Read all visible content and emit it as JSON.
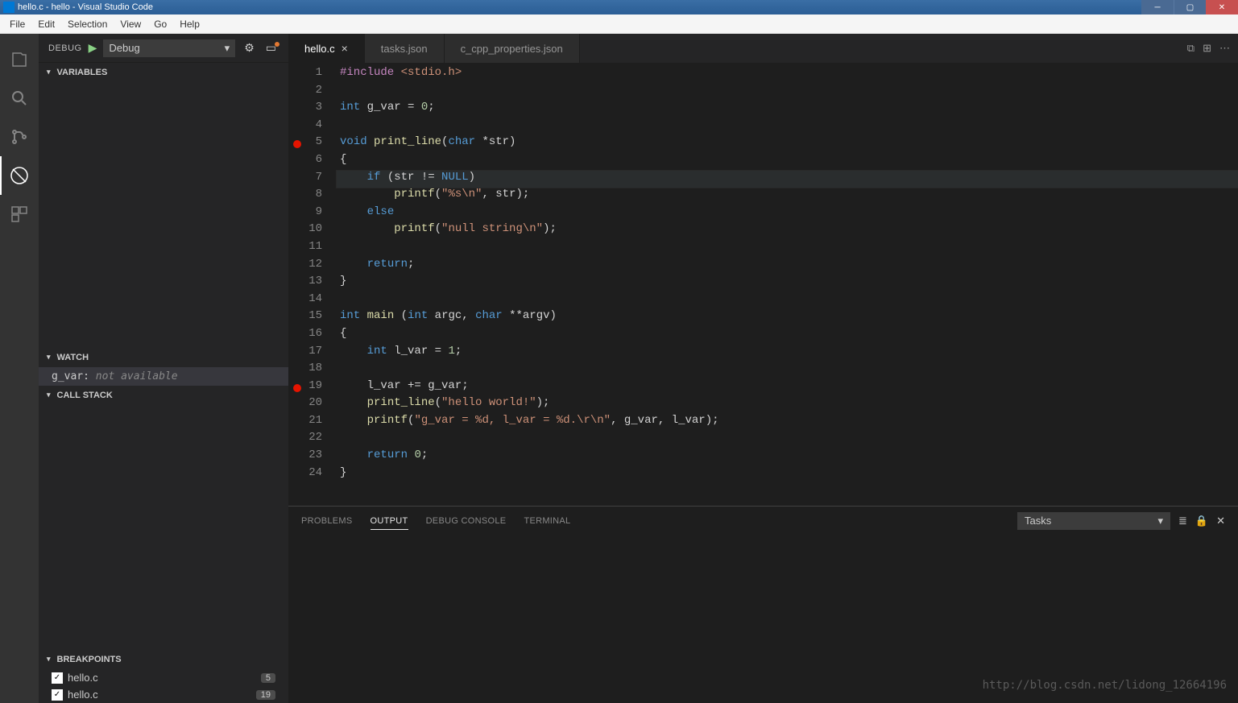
{
  "window": {
    "title": "hello.c - hello - Visual Studio Code"
  },
  "menu": {
    "items": [
      "File",
      "Edit",
      "Selection",
      "View",
      "Go",
      "Help"
    ]
  },
  "sidebar": {
    "debug_label": "DEBUG",
    "config_name": "Debug",
    "sections": {
      "variables": "VARIABLES",
      "watch": "WATCH",
      "callstack": "CALL STACK",
      "breakpoints": "BREAKPOINTS"
    },
    "watch": [
      {
        "expr": "g_var:",
        "value": "not available"
      }
    ],
    "breakpoints": [
      {
        "file": "hello.c",
        "line": "5",
        "checked": true
      },
      {
        "file": "hello.c",
        "line": "19",
        "checked": true
      }
    ]
  },
  "tabs": [
    {
      "label": "hello.c",
      "active": true
    },
    {
      "label": "tasks.json",
      "active": false
    },
    {
      "label": "c_cpp_properties.json",
      "active": false
    }
  ],
  "panel": {
    "tabs": [
      "PROBLEMS",
      "OUTPUT",
      "DEBUG CONSOLE",
      "TERMINAL"
    ],
    "active": "OUTPUT",
    "selector": "Tasks"
  },
  "watermark": "http://blog.csdn.net/lidong_12664196",
  "code": {
    "breakpoint_lines": [
      5,
      19
    ],
    "current_line": 7,
    "lines": [
      {
        "n": 1,
        "seg": [
          [
            "pp",
            "#include"
          ],
          [
            "txt",
            " "
          ],
          [
            "str",
            "<stdio.h>"
          ]
        ]
      },
      {
        "n": 2,
        "seg": []
      },
      {
        "n": 3,
        "seg": [
          [
            "tp",
            "int"
          ],
          [
            "txt",
            " g_var = "
          ],
          [
            "num",
            "0"
          ],
          [
            "txt",
            ";"
          ]
        ]
      },
      {
        "n": 4,
        "seg": []
      },
      {
        "n": 5,
        "seg": [
          [
            "tp",
            "void"
          ],
          [
            "txt",
            " "
          ],
          [
            "fn",
            "print_line"
          ],
          [
            "txt",
            "("
          ],
          [
            "tp",
            "char"
          ],
          [
            "txt",
            " *str)"
          ]
        ]
      },
      {
        "n": 6,
        "seg": [
          [
            "txt",
            "{"
          ]
        ]
      },
      {
        "n": 7,
        "seg": [
          [
            "txt",
            "    "
          ],
          [
            "kw",
            "if"
          ],
          [
            "txt",
            " (str != "
          ],
          [
            "cst",
            "NULL"
          ],
          [
            "txt",
            ")"
          ]
        ]
      },
      {
        "n": 8,
        "seg": [
          [
            "txt",
            "        "
          ],
          [
            "fn",
            "printf"
          ],
          [
            "txt",
            "("
          ],
          [
            "str",
            "\"%s\\n\""
          ],
          [
            "txt",
            ", str);"
          ]
        ]
      },
      {
        "n": 9,
        "seg": [
          [
            "txt",
            "    "
          ],
          [
            "kw",
            "else"
          ]
        ]
      },
      {
        "n": 10,
        "seg": [
          [
            "txt",
            "        "
          ],
          [
            "fn",
            "printf"
          ],
          [
            "txt",
            "("
          ],
          [
            "str",
            "\"null string\\n\""
          ],
          [
            "txt",
            ");"
          ]
        ]
      },
      {
        "n": 11,
        "seg": []
      },
      {
        "n": 12,
        "seg": [
          [
            "txt",
            "    "
          ],
          [
            "kw",
            "return"
          ],
          [
            "txt",
            ";"
          ]
        ]
      },
      {
        "n": 13,
        "seg": [
          [
            "txt",
            "}"
          ]
        ]
      },
      {
        "n": 14,
        "seg": []
      },
      {
        "n": 15,
        "seg": [
          [
            "tp",
            "int"
          ],
          [
            "txt",
            " "
          ],
          [
            "fn",
            "main"
          ],
          [
            "txt",
            " ("
          ],
          [
            "tp",
            "int"
          ],
          [
            "txt",
            " argc, "
          ],
          [
            "tp",
            "char"
          ],
          [
            "txt",
            " **argv)"
          ]
        ]
      },
      {
        "n": 16,
        "seg": [
          [
            "txt",
            "{"
          ]
        ]
      },
      {
        "n": 17,
        "seg": [
          [
            "txt",
            "    "
          ],
          [
            "tp",
            "int"
          ],
          [
            "txt",
            " l_var = "
          ],
          [
            "num",
            "1"
          ],
          [
            "txt",
            ";"
          ]
        ]
      },
      {
        "n": 18,
        "seg": []
      },
      {
        "n": 19,
        "seg": [
          [
            "txt",
            "    l_var += g_var;"
          ]
        ]
      },
      {
        "n": 20,
        "seg": [
          [
            "txt",
            "    "
          ],
          [
            "fn",
            "print_line"
          ],
          [
            "txt",
            "("
          ],
          [
            "str",
            "\"hello world!\""
          ],
          [
            "txt",
            ");"
          ]
        ]
      },
      {
        "n": 21,
        "seg": [
          [
            "txt",
            "    "
          ],
          [
            "fn",
            "printf"
          ],
          [
            "txt",
            "("
          ],
          [
            "str",
            "\"g_var = %d, l_var = %d.\\r\\n\""
          ],
          [
            "txt",
            ", g_var, l_var);"
          ]
        ]
      },
      {
        "n": 22,
        "seg": []
      },
      {
        "n": 23,
        "seg": [
          [
            "txt",
            "    "
          ],
          [
            "kw",
            "return"
          ],
          [
            "txt",
            " "
          ],
          [
            "num",
            "0"
          ],
          [
            "txt",
            ";"
          ]
        ]
      },
      {
        "n": 24,
        "seg": [
          [
            "txt",
            "}"
          ]
        ]
      }
    ]
  }
}
